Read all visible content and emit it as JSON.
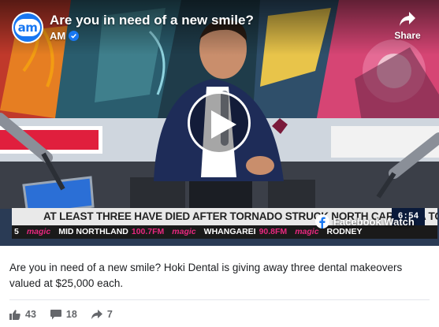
{
  "video": {
    "title": "Are you in need of a new smile?",
    "channel_name": "AM",
    "channel_logo": "am",
    "share_label": "Share",
    "watch_label": "Facebook Watch",
    "ticker_headline": "AT LEAST THREE HAVE DIED AFTER TORNADO STRUCK NORTH CAROLINA TOWN",
    "ticker_brand": "magic",
    "ticker_segments": [
      {
        "place": "MID NORTHLAND",
        "freq": "100.7FM"
      },
      {
        "place": "WHANGAREI",
        "freq": "90.8FM"
      },
      {
        "place": "RODNEY",
        "freq": ""
      }
    ],
    "ticker_left_digit": "5",
    "clock": "6:54"
  },
  "post": {
    "caption": "Are you in need of a new smile? Hoki Dental is giving away three dental makeovers valued at $25,000 each.",
    "likes": "43",
    "comments": "18",
    "shares": "7"
  },
  "colors": {
    "accent": "#1877f2",
    "magic_pink": "#e8287f",
    "stat_gray": "#65676b"
  }
}
